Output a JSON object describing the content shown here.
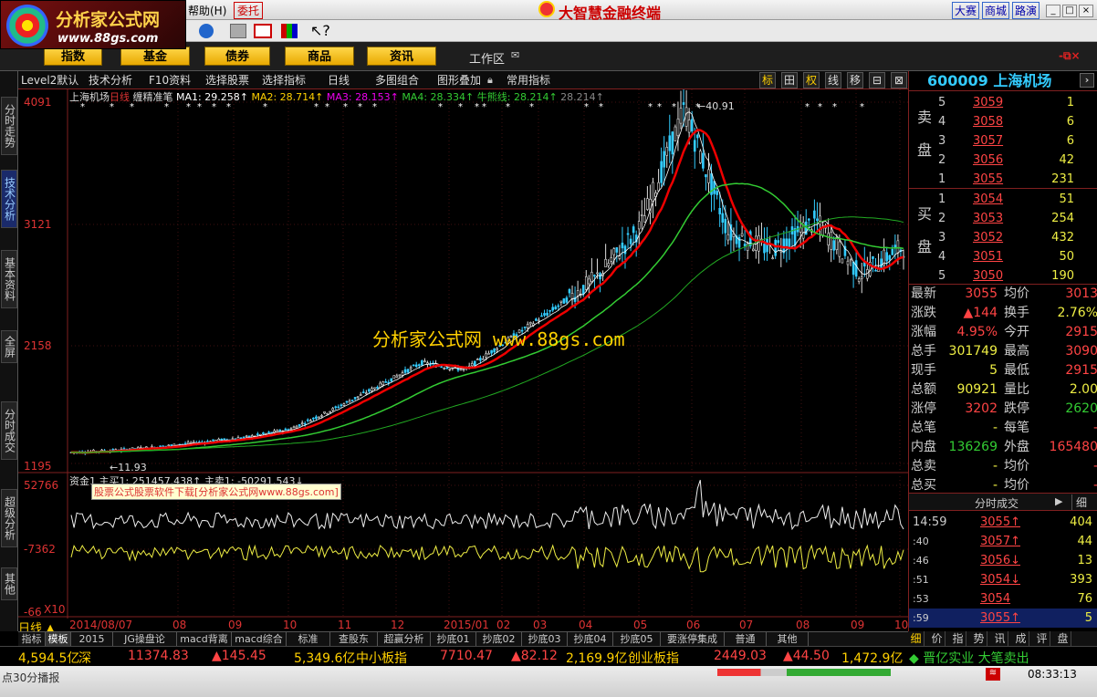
{
  "app": {
    "title": "大智慧金融终端",
    "logo_name": "分析家公式网",
    "logo_url": "www.88gs.com",
    "menu_help": "帮助(H)",
    "menu_entrust": "委托",
    "right_links": [
      "大赛",
      "商城",
      "路演"
    ]
  },
  "nav": {
    "buttons": [
      "指数",
      "基金",
      "债券",
      "商品",
      "资讯"
    ],
    "workspace": "工作区"
  },
  "left_tabs": [
    "分时走势",
    "技术分析",
    "基本资料",
    "全屏",
    "分时成交",
    "超级分析",
    "其他"
  ],
  "chart_toolbar": {
    "items": [
      "Level2默认",
      "技术分析",
      "F10资料",
      "选择股票",
      "选择指标",
      "日线",
      "多图组合",
      "图形叠加",
      "常用指标"
    ],
    "icons": [
      "标",
      "田",
      "权",
      "线",
      "移",
      "⊟",
      "⊠"
    ]
  },
  "chart_header": {
    "name": "上海机场",
    "period": "日线",
    "indicator": "缠精准笔",
    "ma1": "MA1: 29.258↑",
    "ma2": "MA2: 28.714↑",
    "ma3": "MA3: 28.153↑",
    "ma4": "MA4: 28.334↑",
    "bull": "牛熊线: 28.214↑",
    "extra": "28.214↑"
  },
  "watermark": "分析家公式网    www.88gs.com",
  "peak_label": "←40.91",
  "low_label": "←11.93",
  "sub_header": "资金1  主买1: 251457.438↑  主卖1: -50291.543↓",
  "sub_banner": "股票公式股票软件下载[分析家公式网www.88gs.com]",
  "chart_data": {
    "type": "candlestick",
    "price_axis_ticks": [
      "4091",
      "3121",
      "2158",
      "1195"
    ],
    "volume_axis_ticks": [
      "52766",
      "-7362",
      "-66"
    ],
    "volume_multiplier": "X10",
    "x_labels": [
      "2014/08/07",
      "08",
      "09",
      "10",
      "11",
      "12",
      "2015/01",
      "02",
      "03",
      "04",
      "05",
      "06",
      "07",
      "08",
      "09",
      "10"
    ],
    "period_label": "日线",
    "price_trend": [
      11.93,
      12.1,
      12.4,
      12.8,
      13.2,
      13.9,
      15.6,
      17.5,
      19.5,
      18.9,
      21.5,
      24.0,
      26.7,
      31.0,
      40.91,
      30.5,
      29.0,
      31.5,
      27.0,
      29.3
    ]
  },
  "quote": {
    "code": "600009",
    "name": "上海机场",
    "sell_label": "卖盘",
    "buy_label": "买盘",
    "sell": [
      {
        "lv": "5",
        "price": "3059",
        "vol": "1"
      },
      {
        "lv": "4",
        "price": "3058",
        "vol": "6"
      },
      {
        "lv": "3",
        "price": "3057",
        "vol": "6"
      },
      {
        "lv": "2",
        "price": "3056",
        "vol": "42"
      },
      {
        "lv": "1",
        "price": "3055",
        "vol": "231"
      }
    ],
    "buy": [
      {
        "lv": "1",
        "price": "3054",
        "vol": "51"
      },
      {
        "lv": "2",
        "price": "3053",
        "vol": "254"
      },
      {
        "lv": "3",
        "price": "3052",
        "vol": "432"
      },
      {
        "lv": "4",
        "price": "3051",
        "vol": "50"
      },
      {
        "lv": "5",
        "price": "3050",
        "vol": "190"
      }
    ],
    "stats": [
      {
        "k1": "最新",
        "v1": "3055",
        "k2": "均价",
        "v2": "3013"
      },
      {
        "k1": "涨跌",
        "v1": "▲144",
        "k2": "换手",
        "v2": "2.76%"
      },
      {
        "k1": "涨幅",
        "v1": "4.95%",
        "k2": "今开",
        "v2": "2915"
      },
      {
        "k1": "总手",
        "v1": "301749",
        "k2": "最高",
        "v2": "3090"
      },
      {
        "k1": "现手",
        "v1": "5",
        "k2": "最低",
        "v2": "2915"
      },
      {
        "k1": "总额",
        "v1": "90921",
        "k2": "量比",
        "v2": "2.00"
      },
      {
        "k1": "涨停",
        "v1": "3202",
        "k2": "跌停",
        "v2": "2620"
      },
      {
        "k1": "总笔",
        "v1": "-",
        "k2": "每笔",
        "v2": "-"
      },
      {
        "k1": "内盘",
        "v1": "136269",
        "k2": "外盘",
        "v2": "165480"
      },
      {
        "k1": "总卖",
        "v1": "-",
        "k2": "均价",
        "v2": "-"
      },
      {
        "k1": "总买",
        "v1": "-",
        "k2": "均价",
        "v2": "-"
      }
    ],
    "ticks_title": "分时成交",
    "ticks_btn": "细",
    "ticks": [
      {
        "t": "14:59",
        "p": "3055↑",
        "v": "404"
      },
      {
        "t": ":40",
        "p": "3057↑",
        "v": "44"
      },
      {
        "t": ":46",
        "p": "3056↓",
        "v": "13"
      },
      {
        "t": ":51",
        "p": "3054↓",
        "v": "393"
      },
      {
        "t": ":53",
        "p": "3054",
        "v": "76"
      },
      {
        "t": ":59",
        "p": "3055↑",
        "v": "5"
      }
    ]
  },
  "bottom_tabs": [
    "指标",
    "模板",
    "2015",
    "JG操盘论",
    "macd背离",
    "macd综合",
    "标准",
    "查股东",
    "超赢分析",
    "抄底01",
    "抄底02",
    "抄底03",
    "抄底04",
    "抄底05",
    "要涨停集成",
    "普通",
    "其他"
  ],
  "right_tabs": [
    "细",
    "价",
    "指",
    "势",
    "讯",
    "成",
    "评",
    "盘"
  ],
  "ticker": {
    "sh_amt": "4,594.5亿",
    "sz_label": "深",
    "sz_idx": "11374.83",
    "sz_chg": "▲145.45",
    "zx_amt": "5,349.6亿",
    "zx_label": "中小板指",
    "zx_idx": "7710.47",
    "zx_chg": "▲82.12",
    "cy_amt": "2,169.9亿",
    "cy_label": "创业板指",
    "cy_idx": "2449.03",
    "cy_chg": "▲44.50",
    "cy_amt2": "1,472.9亿",
    "news": "◆ 晋亿实业 大笔卖出"
  },
  "status": {
    "left": "点30分播报",
    "time": "08:33:13"
  }
}
